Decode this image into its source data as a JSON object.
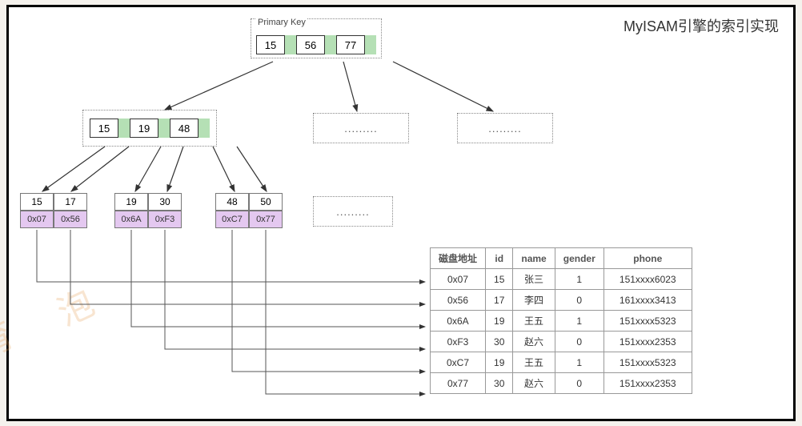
{
  "title": "MyISAM引擎的索引实现",
  "root_label": "Primary Key",
  "root_keys": [
    "15",
    "56",
    "77"
  ],
  "mid_keys": [
    "15",
    "19",
    "48"
  ],
  "mid_placeholder": ".........",
  "leaf_placeholder": ".........",
  "leaves": [
    {
      "keys": [
        "15",
        "17"
      ],
      "addrs": [
        "0x07",
        "0x56"
      ]
    },
    {
      "keys": [
        "19",
        "30"
      ],
      "addrs": [
        "0x6A",
        "0xF3"
      ]
    },
    {
      "keys": [
        "48",
        "50"
      ],
      "addrs": [
        "0xC7",
        "0x77"
      ]
    }
  ],
  "table": {
    "headers": [
      "磁盘地址",
      "id",
      "name",
      "gender",
      "phone"
    ],
    "rows": [
      [
        "0x07",
        "15",
        "张三",
        "1",
        "151xxxx6023"
      ],
      [
        "0x56",
        "17",
        "李四",
        "0",
        "161xxxx3413"
      ],
      [
        "0x6A",
        "19",
        "王五",
        "1",
        "151xxxx5323"
      ],
      [
        "0xF3",
        "30",
        "赵六",
        "0",
        "151xxxx2353"
      ],
      [
        "0xC7",
        "19",
        "王五",
        "1",
        "151xxxx5323"
      ],
      [
        "0x77",
        "30",
        "赵六",
        "0",
        "151xxxx2353"
      ]
    ]
  },
  "chart_data": {
    "type": "table",
    "title": "MyISAM B+Tree index (non-clustered) — leaves hold disk addresses",
    "index_tree": {
      "root": {
        "keys": [
          15,
          56,
          77
        ]
      },
      "children_of_first_pointer": {
        "keys": [
          15,
          19,
          48
        ]
      },
      "leaf_nodes": [
        {
          "keys": [
            15,
            17
          ],
          "disk_addresses": [
            "0x07",
            "0x56"
          ]
        },
        {
          "keys": [
            19,
            30
          ],
          "disk_addresses": [
            "0x6A",
            "0xF3"
          ]
        },
        {
          "keys": [
            48,
            50
          ],
          "disk_addresses": [
            "0xC7",
            "0x77"
          ]
        }
      ]
    },
    "data_file": [
      {
        "address": "0x07",
        "id": 15,
        "name": "张三",
        "gender": 1,
        "phone": "151xxxx6023"
      },
      {
        "address": "0x56",
        "id": 17,
        "name": "李四",
        "gender": 0,
        "phone": "161xxxx3413"
      },
      {
        "address": "0x6A",
        "id": 19,
        "name": "王五",
        "gender": 1,
        "phone": "151xxxx5323"
      },
      {
        "address": "0xF3",
        "id": 30,
        "name": "赵六",
        "gender": 0,
        "phone": "151xxxx2353"
      },
      {
        "address": "0xC7",
        "id": 19,
        "name": "王五",
        "gender": 1,
        "phone": "151xxxx5323"
      },
      {
        "address": "0x77",
        "id": 30,
        "name": "赵六",
        "gender": 0,
        "phone": "151xxxx2353"
      }
    ]
  }
}
